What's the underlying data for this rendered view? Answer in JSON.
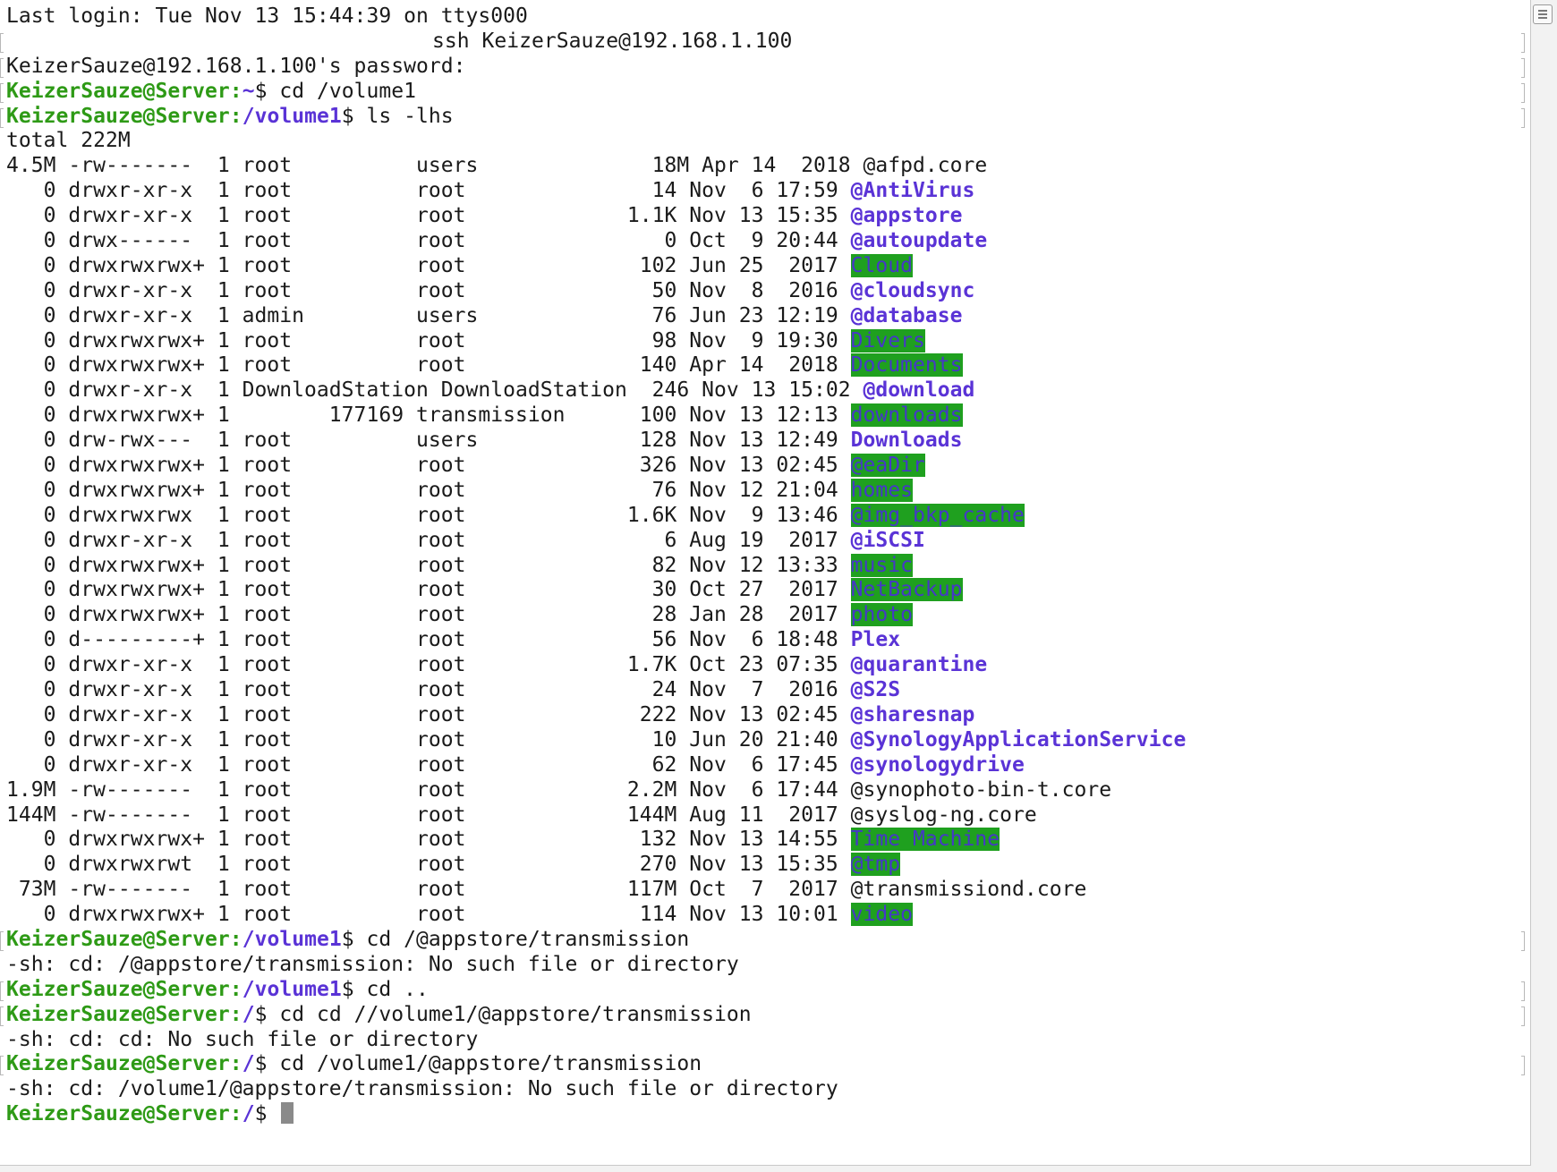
{
  "prompt": {
    "user_host": "KeizerSauze@Server",
    "sep": ":",
    "home": "~",
    "volume": "/volume1",
    "root": "/",
    "symbol": "$"
  },
  "lines": {
    "login": "Last login: Tue Nov 13 15:44:39 on ttys000",
    "ssh_command": "ssh KeizerSauze@192.168.1.100",
    "password_prompt": "KeizerSauze@192.168.1.100's password:",
    "cmd_cd_volume": " cd /volume1",
    "cmd_ls": " ls -lhs",
    "total": "total 222M",
    "cmd_cd_appstore": " cd /@appstore/transmission",
    "err_appstore": "-sh: cd: /@appstore/transmission: No such file or directory",
    "cmd_cd_up": " cd ..",
    "cmd_cd_cd": " cd cd //volume1/@appstore/transmission",
    "err_cd_cd": "-sh: cd: cd: No such file or directory",
    "cmd_cd_vol_app": " cd /volume1/@appstore/transmission",
    "err_vol_app": "-sh: cd: /volume1/@appstore/transmission: No such file or directory",
    "cursor_space": " "
  },
  "listing": [
    {
      "info": "4.5M -rw-------  1 root          users              18M Apr 14  2018 ",
      "name": "@afpd.core",
      "cls": "n"
    },
    {
      "info": "   0 drwxr-xr-x  1 root          root               14 Nov  6 17:59 ",
      "name": "@AntiVirus",
      "cls": "f"
    },
    {
      "info": "   0 drwxr-xr-x  1 root          root             1.1K Nov 13 15:35 ",
      "name": "@appstore",
      "cls": "f"
    },
    {
      "info": "   0 drwx------  1 root          root                0 Oct  9 20:44 ",
      "name": "@autoupdate",
      "cls": "f"
    },
    {
      "info": "   0 drwxrwxrwx+ 1 root          root              102 Jun 25  2017 ",
      "name": "Cloud",
      "cls": "f hl"
    },
    {
      "info": "   0 drwxr-xr-x  1 root          root               50 Nov  8  2016 ",
      "name": "@cloudsync",
      "cls": "f"
    },
    {
      "info": "   0 drwxr-xr-x  1 admin         users              76 Jun 23 12:19 ",
      "name": "@database",
      "cls": "f"
    },
    {
      "info": "   0 drwxrwxrwx+ 1 root          root               98 Nov  9 19:30 ",
      "name": "Divers",
      "cls": "f hl"
    },
    {
      "info": "   0 drwxrwxrwx+ 1 root          root              140 Apr 14  2018 ",
      "name": "Documents",
      "cls": "f hl"
    },
    {
      "info": "   0 drwxr-xr-x  1 DownloadStation DownloadStation  246 Nov 13 15:02 ",
      "name": "@download",
      "cls": "f"
    },
    {
      "info": "   0 drwxrwxrwx+ 1        177169 transmission      100 Nov 13 12:13 ",
      "name": "downloads",
      "cls": "f hl"
    },
    {
      "info": "   0 drw-rwx---  1 root          users             128 Nov 13 12:49 ",
      "name": "Downloads",
      "cls": "f"
    },
    {
      "info": "   0 drwxrwxrwx+ 1 root          root              326 Nov 13 02:45 ",
      "name": "@eaDir",
      "cls": "f hl"
    },
    {
      "info": "   0 drwxrwxrwx+ 1 root          root               76 Nov 12 21:04 ",
      "name": "homes",
      "cls": "f hl"
    },
    {
      "info": "   0 drwxrwxrwx  1 root          root             1.6K Nov  9 13:46 ",
      "name": "@img_bkp_cache",
      "cls": "f hl"
    },
    {
      "info": "   0 drwxr-xr-x  1 root          root                6 Aug 19  2017 ",
      "name": "@iSCSI",
      "cls": "f"
    },
    {
      "info": "   0 drwxrwxrwx+ 1 root          root               82 Nov 12 13:33 ",
      "name": "music",
      "cls": "f hl"
    },
    {
      "info": "   0 drwxrwxrwx+ 1 root          root               30 Oct 27  2017 ",
      "name": "NetBackup",
      "cls": "f hl"
    },
    {
      "info": "   0 drwxrwxrwx+ 1 root          root               28 Jan 28  2017 ",
      "name": "photo",
      "cls": "f hl"
    },
    {
      "info": "   0 d---------+ 1 root          root               56 Nov  6 18:48 ",
      "name": "Plex",
      "cls": "f"
    },
    {
      "info": "   0 drwxr-xr-x  1 root          root             1.7K Oct 23 07:35 ",
      "name": "@quarantine",
      "cls": "f"
    },
    {
      "info": "   0 drwxr-xr-x  1 root          root               24 Nov  7  2016 ",
      "name": "@S2S",
      "cls": "f"
    },
    {
      "info": "   0 drwxr-xr-x  1 root          root              222 Nov 13 02:45 ",
      "name": "@sharesnap",
      "cls": "f"
    },
    {
      "info": "   0 drwxr-xr-x  1 root          root               10 Jun 20 21:40 ",
      "name": "@SynologyApplicationService",
      "cls": "f"
    },
    {
      "info": "   0 drwxr-xr-x  1 root          root               62 Nov  6 17:45 ",
      "name": "@synologydrive",
      "cls": "f"
    },
    {
      "info": "1.9M -rw-------  1 root          root             2.2M Nov  6 17:44 ",
      "name": "@synophoto-bin-t.core",
      "cls": "n"
    },
    {
      "info": "144M -rw-------  1 root          root             144M Aug 11  2017 ",
      "name": "@syslog-ng.core",
      "cls": "n"
    },
    {
      "info": "   0 drwxrwxrwx+ 1 root          root              132 Nov 13 14:55 ",
      "name": "Time Machine",
      "cls": "f hl"
    },
    {
      "info": "   0 drwxrwxrwt  1 root          root              270 Nov 13 15:35 ",
      "name": "@tmp",
      "cls": "f hl"
    },
    {
      "info": " 73M -rw-------  1 root          root             117M Oct  7  2017 ",
      "name": "@transmissiond.core",
      "cls": "n"
    },
    {
      "info": "   0 drwxrwxrwx+ 1 root          root              114 Nov 13 10:01 ",
      "name": "video",
      "cls": "f hl"
    }
  ]
}
